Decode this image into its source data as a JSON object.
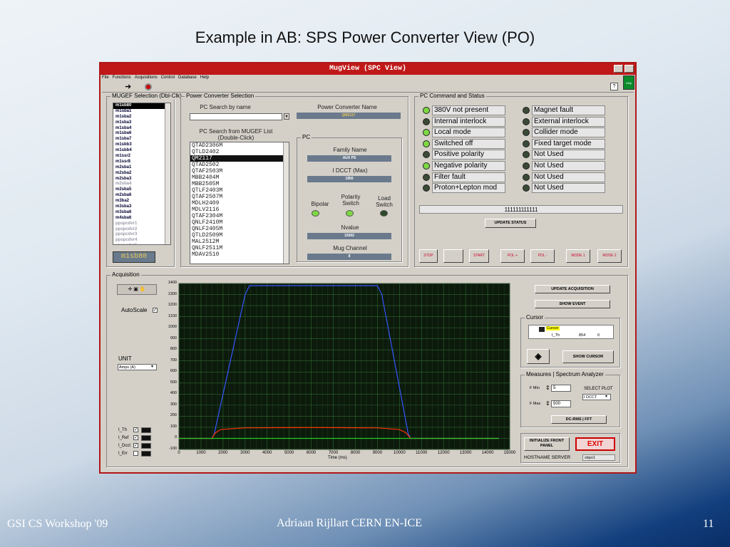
{
  "slide": {
    "title": "Example in AB: SPS Power Converter View (PO)",
    "footer_left": "GSI CS Workshop '09",
    "footer_center": "Adriaan Rijllart CERN EN-ICE",
    "page_number": "11"
  },
  "window": {
    "title": "MugView (SPC View)",
    "menu": [
      "File",
      "Functions",
      "Acquisitions",
      "Control",
      "Database",
      "Help"
    ],
    "corner_label": "Help"
  },
  "mugef": {
    "group_title": "MUGEF Selection (Dbl-Clk)",
    "items": [
      "m1sb80",
      "m1sba1",
      "m1sba2",
      "m1sba3",
      "m1sba4",
      "m1sba6",
      "m1sba7",
      "m1sbb3",
      "m1sbb4",
      "m1ssr2",
      "m1ssr8",
      "m2sba1",
      "m2sba2",
      "m2sba3",
      "m2sba4",
      "m2sba5",
      "m2sba6",
      "m3ba2",
      "m3sba3",
      "m3sba6",
      "m4sba6",
      "ppspcdvr1",
      "ppspcdvr2",
      "ppspcdvr3",
      "ppspcdvr4",
      "ppspcdvr5"
    ],
    "selected_display": "m1sb80"
  },
  "pcsel": {
    "group_title": "Power Converter Selection",
    "search_label": "PC Search by name",
    "search_value": "",
    "name_label": "Power Converter Name",
    "name_value": "QM2117",
    "list_label": "PC Search from MUGEF List (Double-Click)",
    "items": [
      "QTAD2306M",
      "QTLD2402",
      "QM2117",
      "QTAD2502",
      "QTAF2503M",
      "MBB2404M",
      "MBB2505M",
      "QTLF2403M",
      "QTAF2507M",
      "MDLH2409",
      "MDLV2116",
      "QTAF2304M",
      "QNLF2410M",
      "QNLF2405M",
      "QTLD2509M",
      "MAL2512M",
      "QNLF2511M",
      "MDAV2510"
    ]
  },
  "pc": {
    "group_title": "PC",
    "family_label": "Family Name",
    "family_value": "AUX PS",
    "idcct_label": "I DCCT (Max)",
    "idcct_value": "1950",
    "bipolar": "Bipolar",
    "polarity": "Polarity Switch",
    "load": "Load Switch",
    "nvalue_label": "Nvalue",
    "nvalue_value": "15002",
    "mug_label": "Mug Channel",
    "mug_value": "8"
  },
  "status": {
    "group_title": "PC Command and Status",
    "left": [
      "380V not present",
      "Internal interlock",
      "Local mode",
      "Switched off",
      "Positive polarity",
      "Negative polarity",
      "Filter fault",
      "Proton+Lepton mod"
    ],
    "right": [
      "Magnet fault",
      "External interlock",
      "Collider mode",
      "Fixed target mode",
      "Not Used",
      "Not Used",
      "Not Used",
      "Not Used"
    ],
    "bits": "111111111111",
    "update_button": "UPDATE STATUS",
    "commands": [
      "STOP",
      "RESET",
      "START",
      "POL +",
      "POL -",
      "MODE 1",
      "MODE 2"
    ]
  },
  "acq": {
    "group_title": "Acquisition",
    "autoscale": "AutoScale",
    "unit_label": "UNIT",
    "unit_value": "Amps (A)",
    "signals": [
      "I_Th",
      "I_Ref",
      "I_Dcct",
      "I_Err"
    ],
    "update_button": "UPDATE ACQUISITION",
    "event_button": "SHOW EVENT",
    "cursor_group": "Cursor",
    "cursor_name": "Cursor",
    "cursor_signal": "I_Th",
    "cursor_x": "854",
    "cursor_y": "0",
    "show_cursor": "SHOW CURSOR",
    "measures_group": "Measures | Spectrum Analyzer",
    "fmin_label": "F Min",
    "fmin_value": "5",
    "fmax_label": "F Max",
    "fmax_value": "500",
    "select_plot": "SELECT PLOT",
    "select_value": "I DCCT",
    "dcrms": "DC-RMS | FFT",
    "init_button": "INITIALIZE FRONT PANEL",
    "exit_button": "EXIT",
    "hostname_label": "HOSTNAME SERVER",
    "hostname_value": "sbpo1"
  },
  "chart_data": {
    "type": "line",
    "xlabel": "Time (ms)",
    "ylabel": "",
    "xlim": [
      0,
      15000
    ],
    "ylim": [
      -100,
      1400
    ],
    "xticks": [
      0,
      1000,
      2000,
      3000,
      4000,
      5000,
      6000,
      7000,
      8000,
      9000,
      10000,
      11000,
      12000,
      13000,
      14000,
      15000
    ],
    "yticks": [
      -100,
      0,
      100,
      200,
      300,
      400,
      500,
      600,
      700,
      800,
      900,
      1000,
      1100,
      1200,
      1300,
      1400
    ],
    "grid": true,
    "series": [
      {
        "color": "#3355ff",
        "x": [
          0,
          1500,
          1600,
          3000,
          3200,
          9000,
          9200,
          10400,
          10500,
          14500
        ],
        "y": [
          0,
          0,
          40,
          1300,
          1380,
          1380,
          1300,
          40,
          0,
          0
        ]
      },
      {
        "color": "#ff3300",
        "x": [
          0,
          1500,
          1650,
          1900,
          3000,
          6000,
          9000,
          10000,
          10300,
          10500,
          14500
        ],
        "y": [
          0,
          0,
          50,
          80,
          95,
          98,
          95,
          80,
          50,
          0,
          0
        ]
      },
      {
        "color": "#22cc22",
        "x": [
          0,
          14500
        ],
        "y": [
          0,
          0
        ]
      }
    ]
  }
}
